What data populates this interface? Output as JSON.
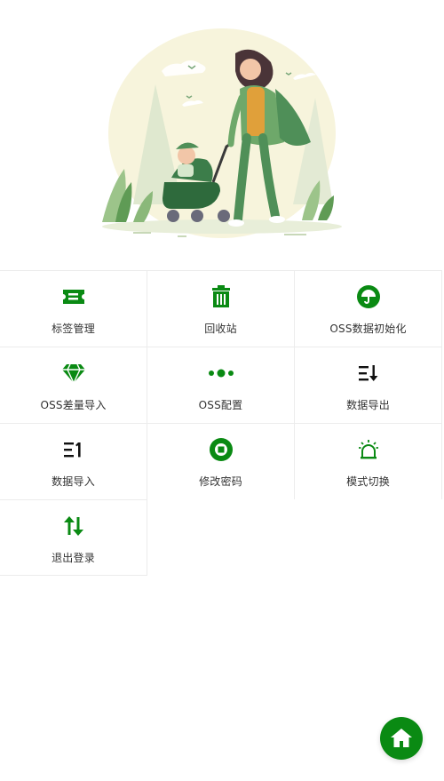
{
  "colors": {
    "accent": "#0a8a13",
    "icon_dark": "#111111",
    "border": "#ececec"
  },
  "hero": {
    "illustration": "mother-pushing-stroller-illustration"
  },
  "menu": [
    {
      "label": "标签管理",
      "icon": "ticket-icon"
    },
    {
      "label": "回收站",
      "icon": "trash-icon"
    },
    {
      "label": "OSS数据初始化",
      "icon": "umbrella-icon"
    },
    {
      "label": "OSS差量导入",
      "icon": "diamond-icon"
    },
    {
      "label": "OSS配置",
      "icon": "dots-icon"
    },
    {
      "label": "数据导出",
      "icon": "sort-descending-icon"
    },
    {
      "label": "数据导入",
      "icon": "sort-ascending-icon"
    },
    {
      "label": "修改密码",
      "icon": "stop-circle-icon"
    },
    {
      "label": "模式切换",
      "icon": "alarm-light-icon"
    },
    {
      "label": "退出登录",
      "icon": "swap-vertical-icon"
    }
  ],
  "fab": {
    "icon": "home-icon"
  }
}
